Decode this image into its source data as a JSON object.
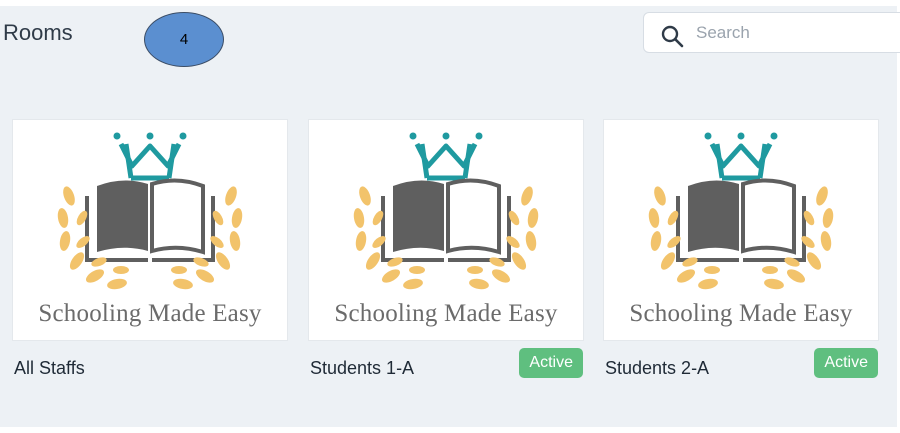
{
  "header": {
    "title": "Rooms",
    "count_badge": "4",
    "search": {
      "placeholder": "Search",
      "value": "",
      "icon": "search-icon"
    }
  },
  "logo_text": "Schooling Made Easy",
  "colors": {
    "page_background": "#edf1f5",
    "badge_fill": "#5b8fd0",
    "active_badge": "#5fbf7f",
    "crown": "#1f9aa0",
    "laurel": "#f2c36b",
    "book": "#5f5f5f"
  },
  "rooms": [
    {
      "name": "All Staffs",
      "status": ""
    },
    {
      "name": "Students 1-A",
      "status": "Active"
    },
    {
      "name": "Students 2-A",
      "status": "Active"
    }
  ]
}
